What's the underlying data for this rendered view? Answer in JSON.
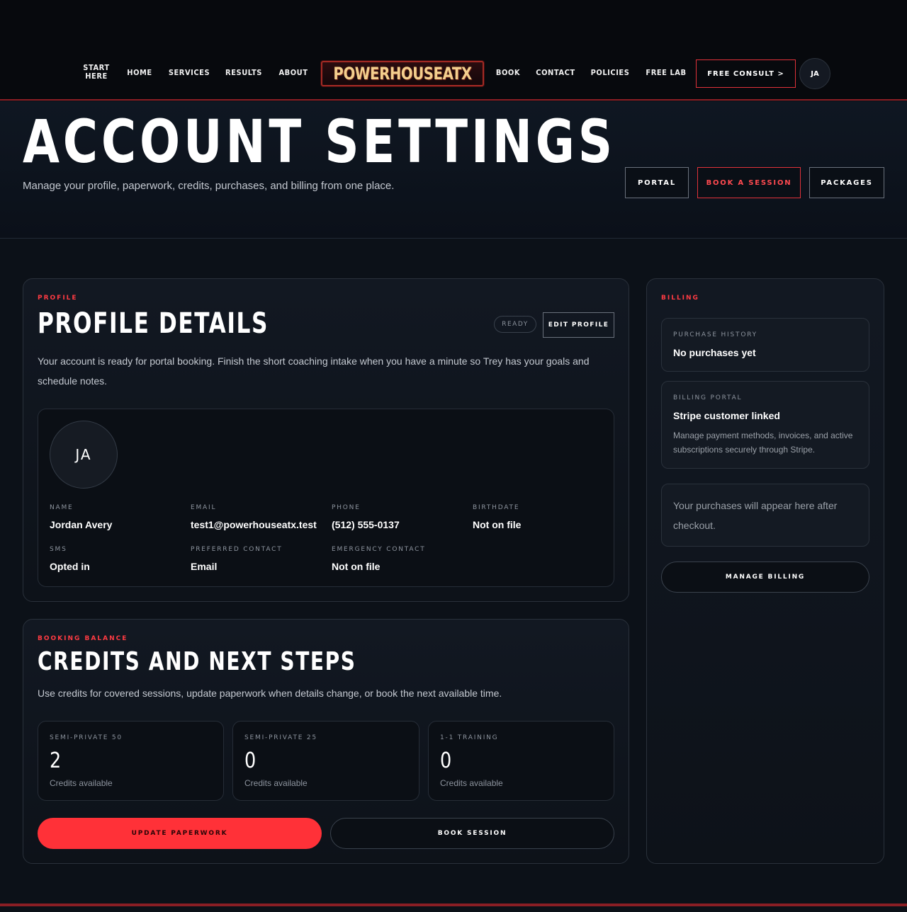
{
  "nav": {
    "start_here_line1": "START",
    "start_here_line2": "HERE",
    "links": [
      "HOME",
      "SERVICES",
      "RESULTS",
      "ABOUT",
      "BOOK",
      "CONTACT",
      "POLICIES",
      "FREE LAB"
    ],
    "logo_text": "POWERHOUSEATX",
    "consult_label": "FREE CONSULT  >",
    "avatar_initials": "JA"
  },
  "hero": {
    "title": "ACCOUNT SETTINGS",
    "subtitle": "Manage your profile, paperwork, credits, purchases, and billing from one place.",
    "buttons": [
      "PORTAL",
      "BOOK A SESSION",
      "PACKAGES"
    ]
  },
  "profile": {
    "eyebrow": "PROFILE",
    "title": "PROFILE DETAILS",
    "status": "READY",
    "edit_label": "EDIT PROFILE",
    "description": "Your account is ready for portal booking. Finish the short coaching intake when you have a minute so Trey has your goals and schedule notes.",
    "avatar_initials": "JA",
    "fields": [
      {
        "label": "NAME",
        "value": "Jordan Avery"
      },
      {
        "label": "EMAIL",
        "value": "test1@powerhouseatx.test"
      },
      {
        "label": "PHONE",
        "value": "(512) 555-0137"
      },
      {
        "label": "BIRTHDATE",
        "value": "Not on file"
      },
      {
        "label": "SMS",
        "value": "Opted in"
      },
      {
        "label": "PREFERRED CONTACT",
        "value": "Email"
      },
      {
        "label": "EMERGENCY CONTACT",
        "value": "Not on file"
      }
    ]
  },
  "credits": {
    "eyebrow": "BOOKING BALANCE",
    "title": "CREDITS AND NEXT STEPS",
    "description": "Use credits for covered sessions, update paperwork when details change, or book the next available time.",
    "items": [
      {
        "label": "SEMI-PRIVATE 50",
        "count": "2",
        "sub": "Credits available"
      },
      {
        "label": "SEMI-PRIVATE 25",
        "count": "0",
        "sub": "Credits available"
      },
      {
        "label": "1-1 TRAINING",
        "count": "0",
        "sub": "Credits available"
      }
    ],
    "update_label": "UPDATE PAPERWORK",
    "book_label": "BOOK SESSION"
  },
  "billing": {
    "eyebrow": "BILLING",
    "history_label": "PURCHASE HISTORY",
    "history_value": "No purchases yet",
    "portal_label": "BILLING PORTAL",
    "portal_value": "Stripe customer linked",
    "portal_note": "Manage payment methods, invoices, and active subscriptions securely through Stripe.",
    "empty_note": "Your purchases will appear here after checkout.",
    "manage_label": "MANAGE BILLING"
  },
  "colors": {
    "accent": "#ff3138",
    "background": "#0c1118",
    "logo_gold": "#f3cf8e"
  }
}
